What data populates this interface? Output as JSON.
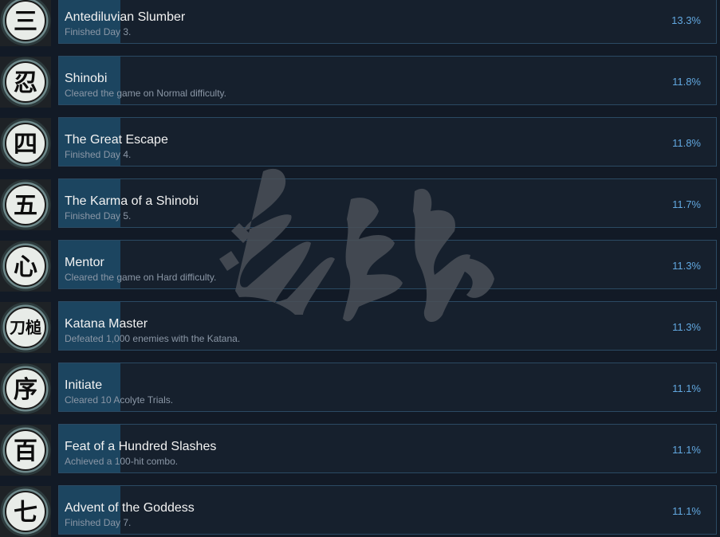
{
  "achievements": [
    {
      "title": "Antediluvian Slumber",
      "description": "Finished Day 3.",
      "percent": "13.3%",
      "icon": "kanji-san-medallion-icon",
      "glyph": "三",
      "fill": 0.093
    },
    {
      "title": "Shinobi",
      "description": "Cleared the game on Normal difficulty.",
      "percent": "11.8%",
      "icon": "kanji-shinobi-medallion-icon",
      "glyph": "忍",
      "fill": 0.093
    },
    {
      "title": "The Great Escape",
      "description": "Finished Day 4.",
      "percent": "11.8%",
      "icon": "kanji-shi-medallion-icon",
      "glyph": "四",
      "fill": 0.093
    },
    {
      "title": "The Karma of a Shinobi",
      "description": "Finished Day 5.",
      "percent": "11.7%",
      "icon": "kanji-go-medallion-icon",
      "glyph": "五",
      "fill": 0.093
    },
    {
      "title": "Mentor",
      "description": "Cleared the game on Hard difficulty.",
      "percent": "11.3%",
      "icon": "kanji-kokoro-medallion-icon",
      "glyph": "心",
      "fill": 0.093
    },
    {
      "title": "Katana Master",
      "description": "Defeated 1,000 enemies with the Katana.",
      "percent": "11.3%",
      "icon": "katana-kanji-icon",
      "glyph": "刀槌",
      "fill": 0.093
    },
    {
      "title": "Initiate",
      "description": "Cleared 10 Acolyte Trials.",
      "percent": "11.1%",
      "icon": "kanji-jo-medallion-icon",
      "glyph": "序",
      "fill": 0.093
    },
    {
      "title": "Feat of a Hundred Slashes",
      "description": "Achieved a 100-hit combo.",
      "percent": "11.1%",
      "icon": "kanji-hyaku-medallion-icon",
      "glyph": "百",
      "fill": 0.093
    },
    {
      "title": "Advent of the Goddess",
      "description": "Finished Day 7.",
      "percent": "11.1%",
      "icon": "kanji-shichi-medallion-icon",
      "glyph": "七",
      "fill": 0.093
    }
  ],
  "watermark": {
    "text": "游侠网",
    "icon": "site-watermark-icon"
  },
  "colors": {
    "background": "#121a26",
    "panel": "#16202d",
    "panel_border": "#2b4a63",
    "progress_fill": "#1c4560",
    "title": "#f2f2f2",
    "description": "#8b97a6",
    "percent": "#62a8e0"
  }
}
